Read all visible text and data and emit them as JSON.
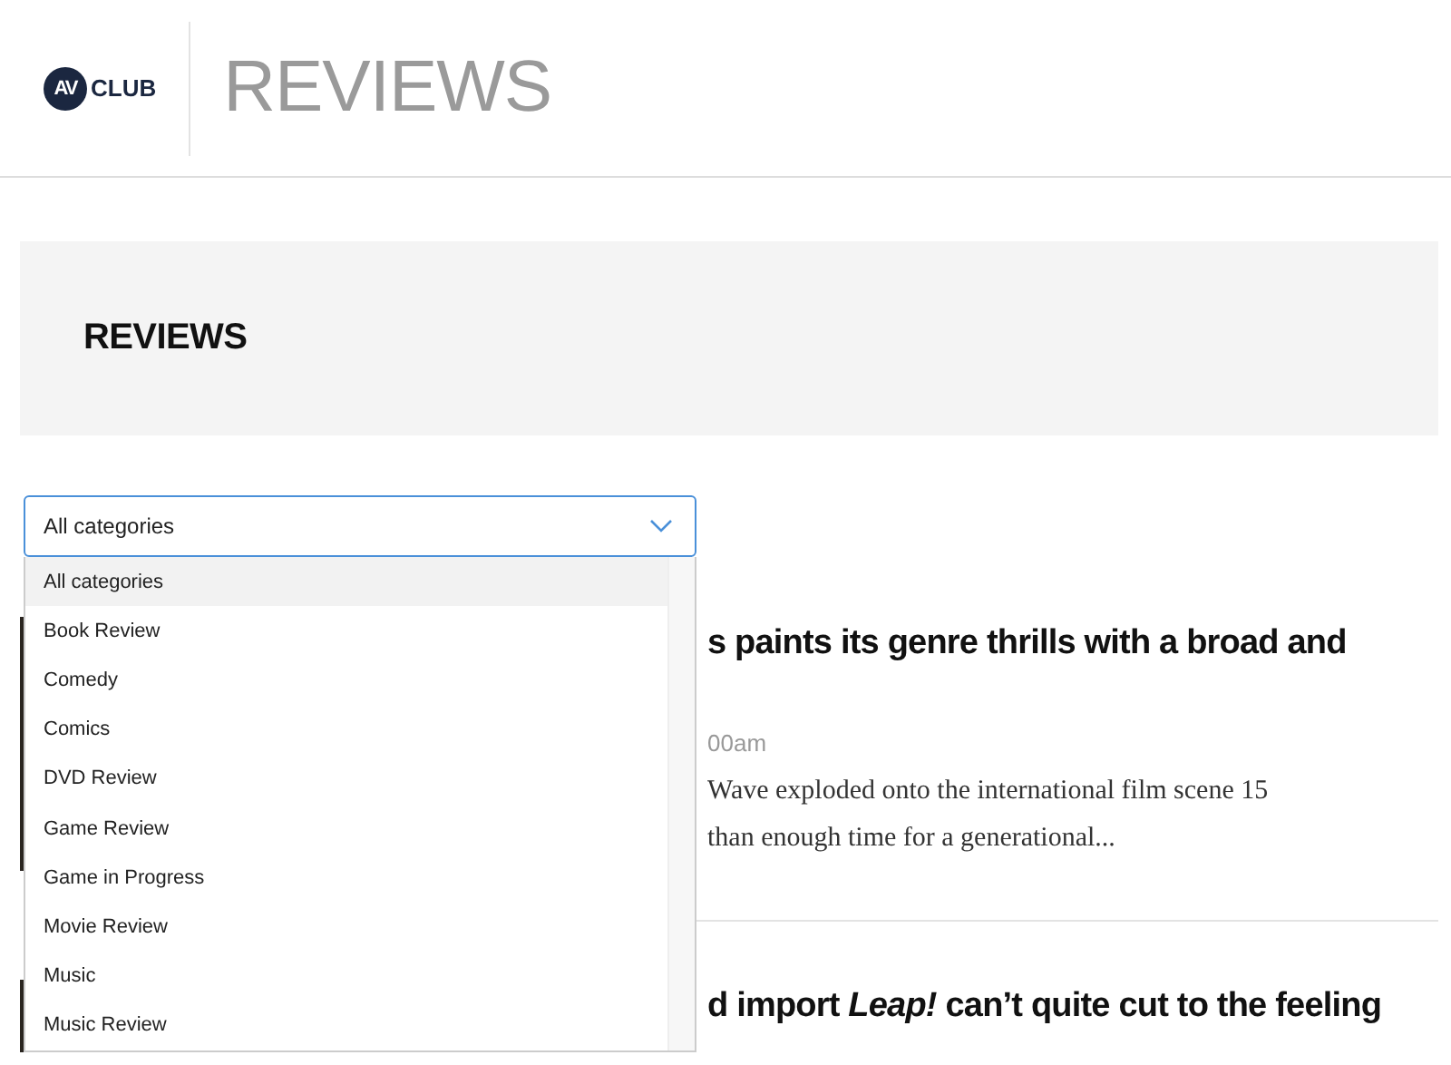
{
  "header": {
    "logo": {
      "badge": "AV",
      "text": "CLUB"
    },
    "section_title": "REVIEWS"
  },
  "banner": {
    "title": "REVIEWS"
  },
  "category_filter": {
    "value": "All categories",
    "expanded": true,
    "options": [
      {
        "label": "All categories",
        "selected": true
      },
      {
        "label": "Book Review",
        "selected": false
      },
      {
        "label": "Comedy",
        "selected": false
      },
      {
        "label": "Comics",
        "selected": false
      },
      {
        "label": "DVD Review",
        "selected": false
      },
      {
        "label": "Game Review",
        "selected": false
      },
      {
        "label": "Game in Progress",
        "selected": false
      },
      {
        "label": "Movie Review",
        "selected": false
      },
      {
        "label": "Music",
        "selected": false
      },
      {
        "label": "Music Review",
        "selected": false
      }
    ]
  },
  "articles": [
    {
      "title": "s paints its genre thrills with a broad and",
      "meta": "00am",
      "excerpt_lines": [
        "Wave exploded onto the international film scene 15",
        "than enough time for a generational..."
      ]
    },
    {
      "title": "d import *Leap!* can’t quite cut to the feeling"
    }
  ]
}
